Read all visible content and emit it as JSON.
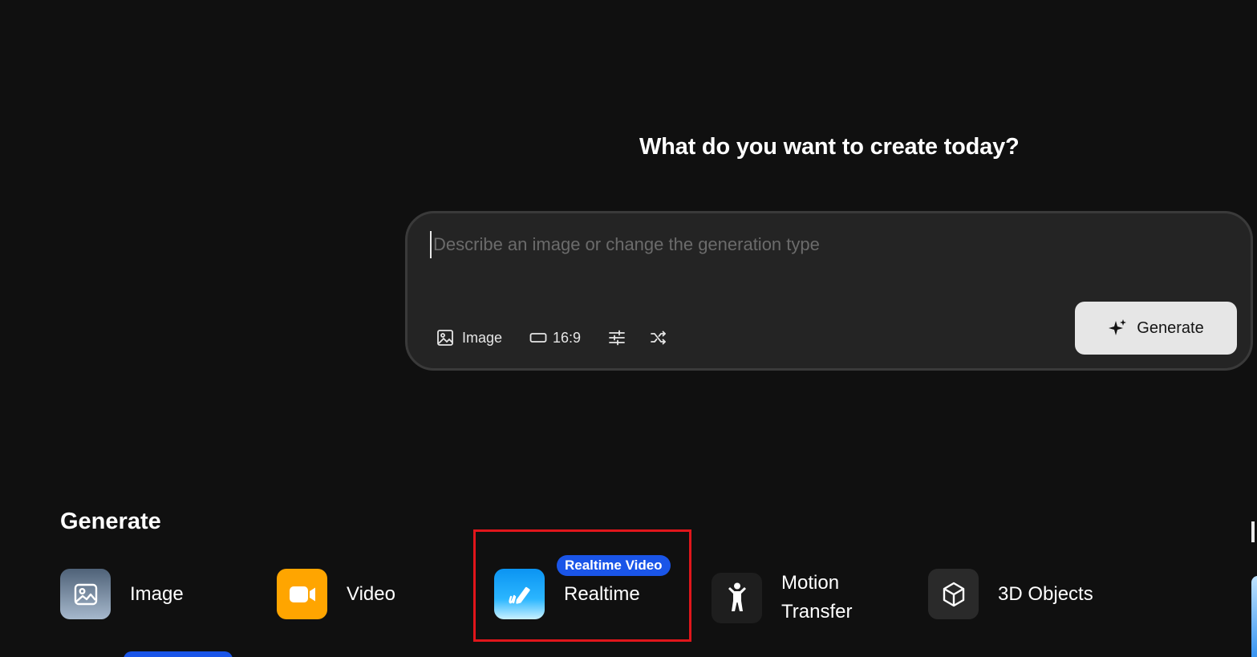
{
  "hero": {
    "title": "What do you want to create today?"
  },
  "prompt": {
    "value": "",
    "placeholder": "Describe an image or change the generation type"
  },
  "toolbar": {
    "type_label": "Image",
    "ratio_label": "16:9",
    "settings_icon": "sliders-icon",
    "shuffle_icon": "shuffle-icon"
  },
  "generate_button": {
    "label": "Generate",
    "icon": "sparkle-icon"
  },
  "generate_section": {
    "title": "Generate",
    "tiles": [
      {
        "label": "Image",
        "icon": "image-icon",
        "color": "#6f8299"
      },
      {
        "label": "Video",
        "icon": "video-camera-icon",
        "color": "#ffa500"
      },
      {
        "label": "Realtime",
        "icon": "pen-icon",
        "color": "#0b94f2",
        "badge": "Realtime Video"
      },
      {
        "label": "Motion Transfer",
        "icon": "person-icon",
        "color": "#1e1e1e"
      },
      {
        "label": "3D Objects",
        "icon": "cube-icon",
        "color": "#2a2a2a"
      }
    ]
  },
  "colors": {
    "background": "#101010",
    "prompt_box": "#242424",
    "badge": "#1a55e8",
    "highlight": "#e0161b"
  }
}
